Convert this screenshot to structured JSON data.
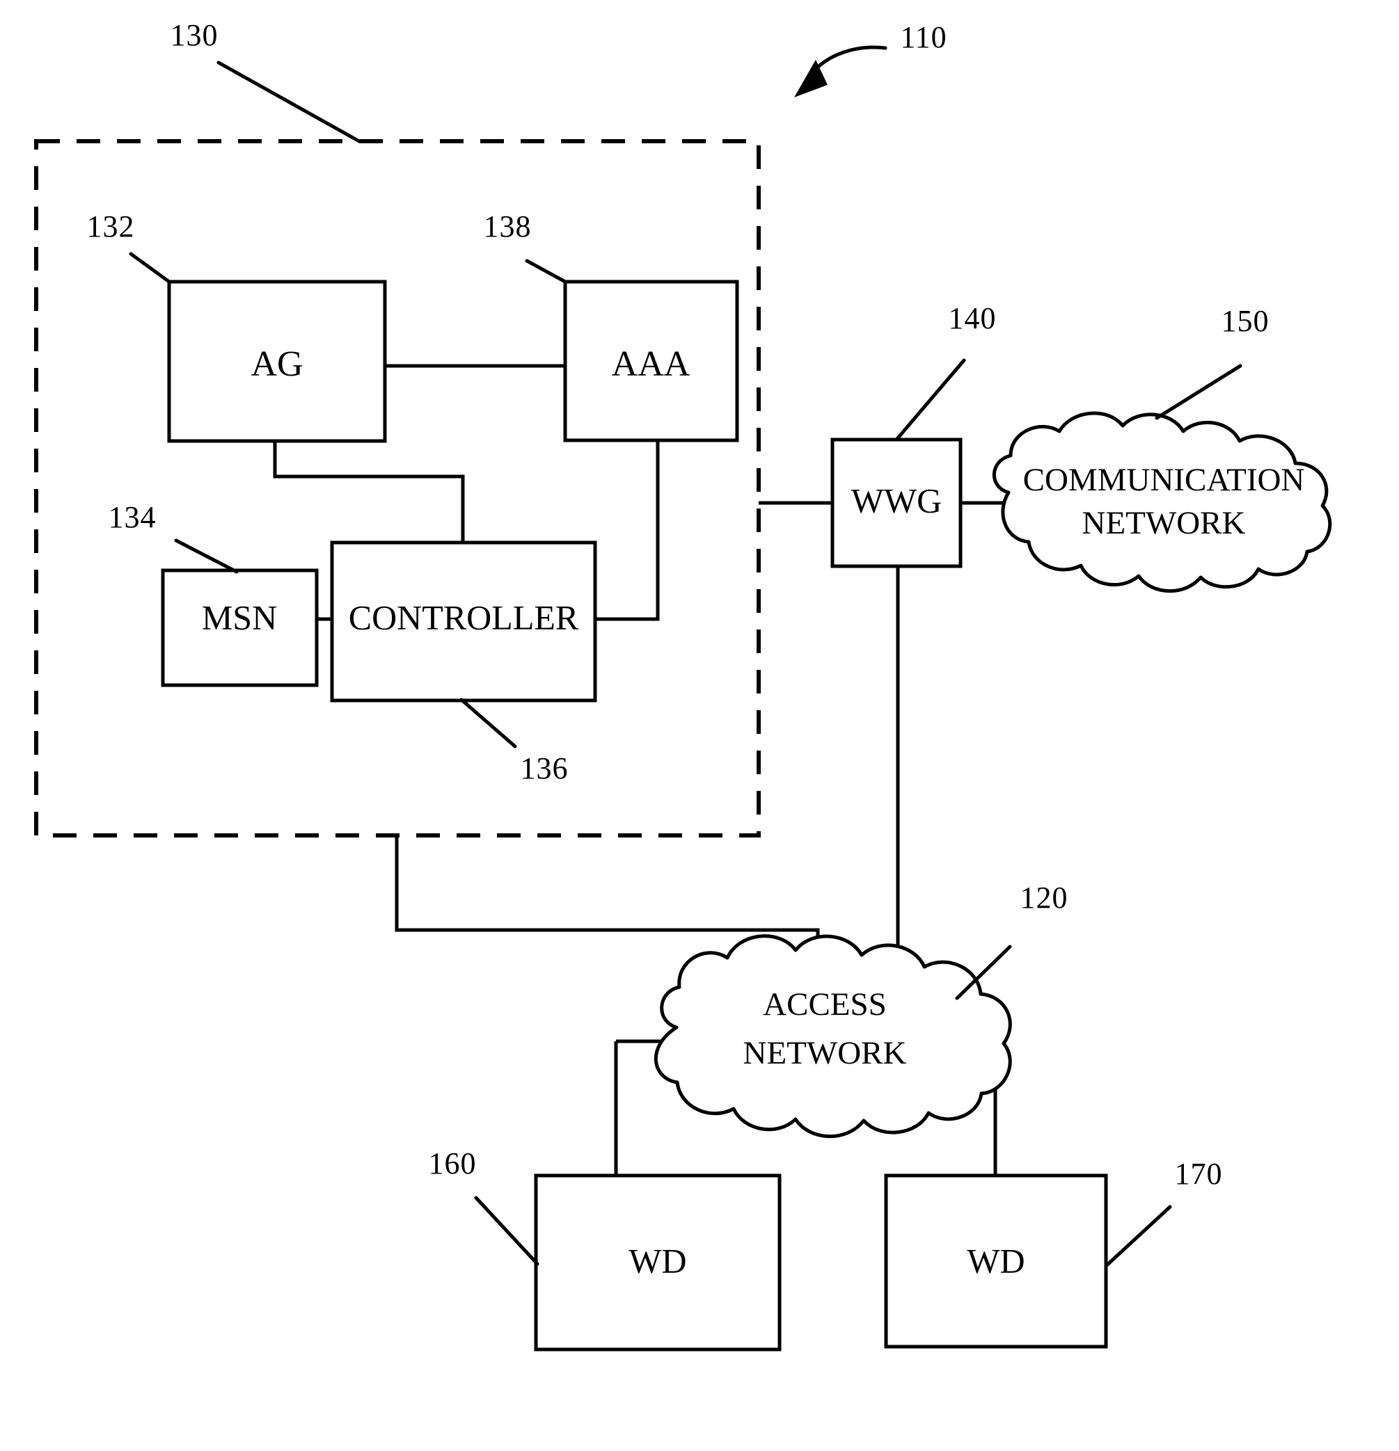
{
  "figure": {
    "overall_ref": "110",
    "boundary_ref": "130",
    "nodes": {
      "ag": {
        "label": "AG",
        "ref": "132"
      },
      "aaa": {
        "label": "AAA",
        "ref": "138"
      },
      "msn": {
        "label": "MSN",
        "ref": "134"
      },
      "controller": {
        "label": "CONTROLLER",
        "ref": "136"
      },
      "wwg": {
        "label": "WWG",
        "ref": "140"
      },
      "communication_network": {
        "label_line1": "COMMUNICATION",
        "label_line2": "NETWORK",
        "ref": "150"
      },
      "access_network": {
        "label_line1": "ACCESS",
        "label_line2": "NETWORK",
        "ref": "120"
      },
      "wd_left": {
        "label": "WD",
        "ref": "160"
      },
      "wd_right": {
        "label": "WD",
        "ref": "170"
      }
    }
  }
}
